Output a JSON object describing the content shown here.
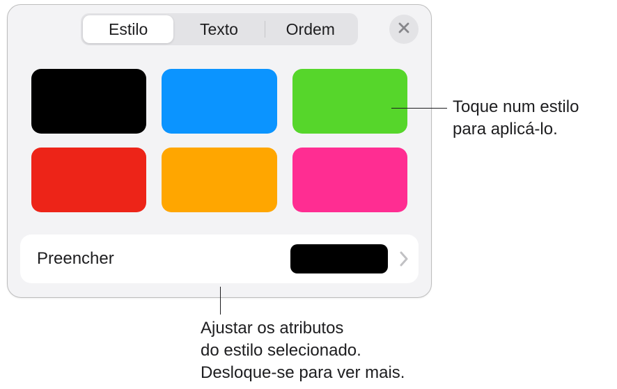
{
  "tabs": {
    "style": "Estilo",
    "text": "Texto",
    "order": "Ordem"
  },
  "swatches": [
    {
      "name": "black",
      "color": "#000000"
    },
    {
      "name": "blue",
      "color": "#0b94ff"
    },
    {
      "name": "green",
      "color": "#56d62b"
    },
    {
      "name": "red",
      "color": "#ed2418"
    },
    {
      "name": "orange",
      "color": "#ffa600"
    },
    {
      "name": "magenta",
      "color": "#ff2d92"
    }
  ],
  "fill": {
    "label": "Preencher",
    "preview_color": "#000000"
  },
  "callouts": {
    "style_swatch": "Toque num estilo\npara aplicá-lo.",
    "fill_row": "Ajustar os atributos\ndo estilo selecionado.\nDesloque-se para ver mais."
  }
}
